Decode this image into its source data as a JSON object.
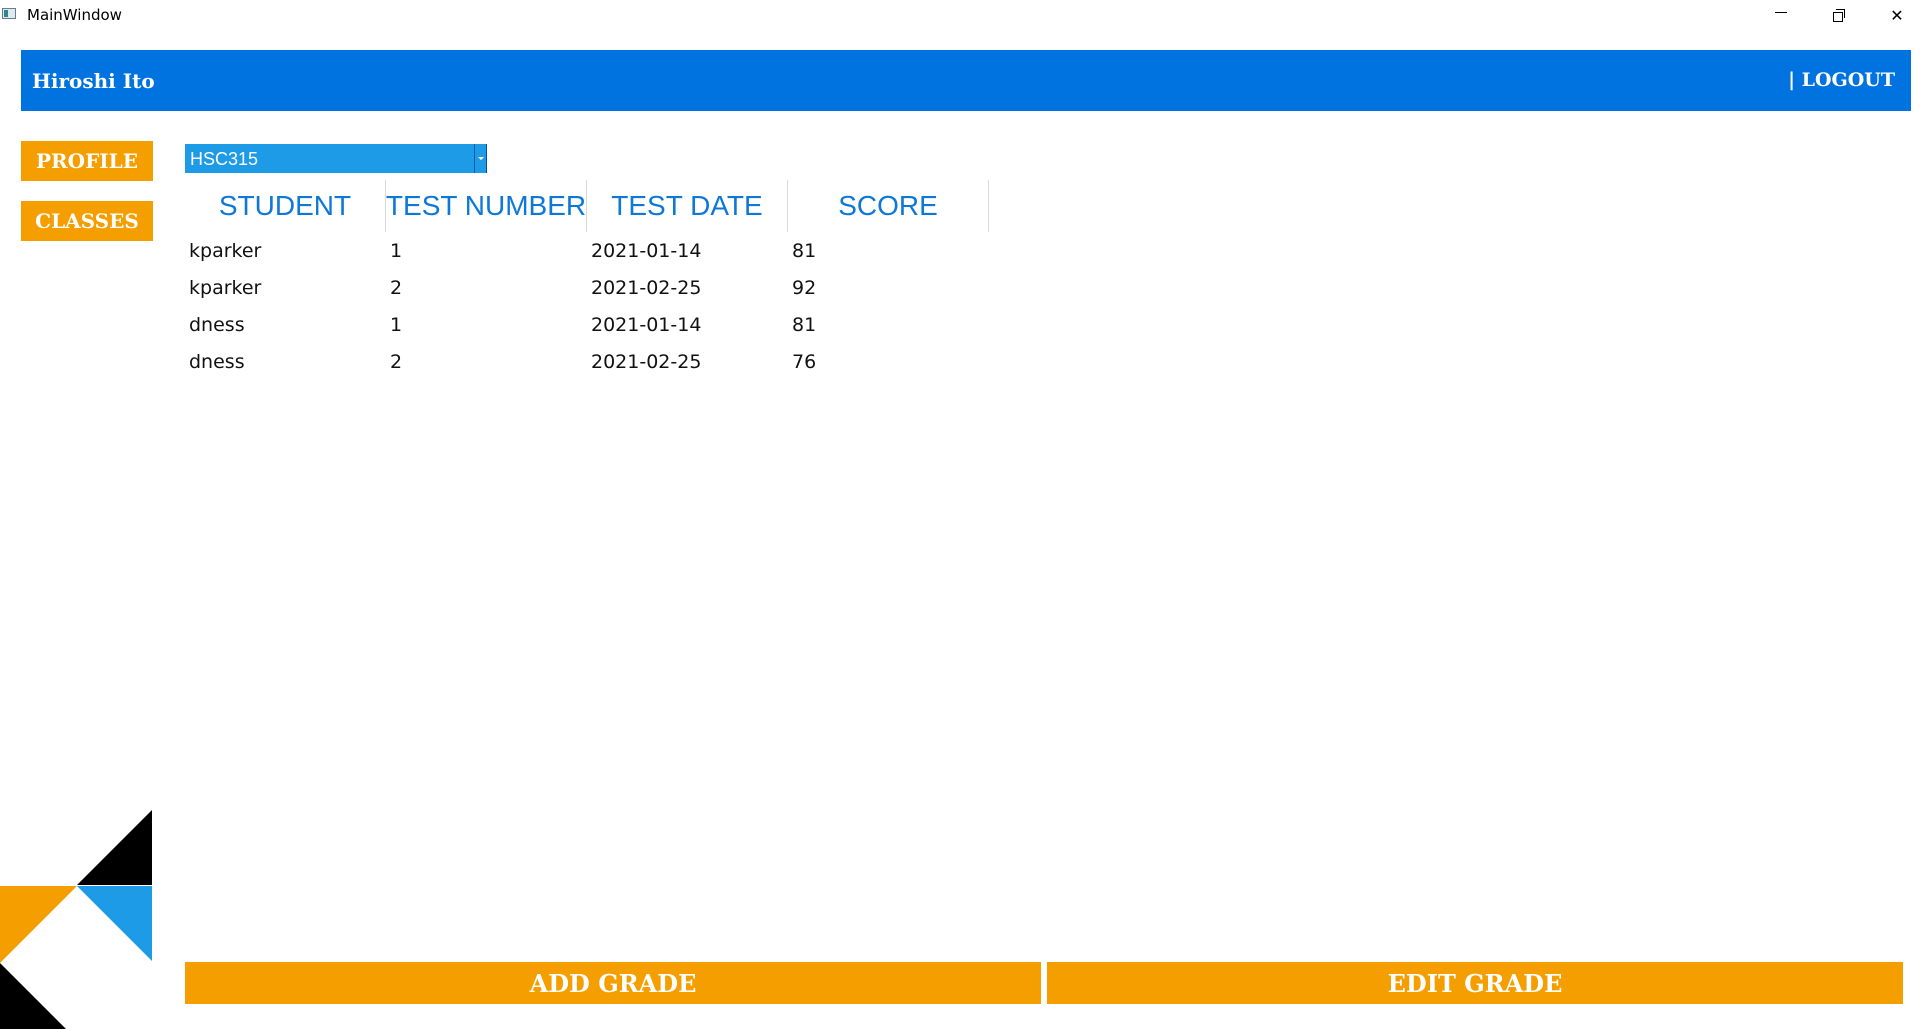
{
  "window": {
    "title": "MainWindow"
  },
  "header": {
    "user_name": "Hiroshi Ito",
    "logout_label": "| LOGOUT"
  },
  "sidebar": {
    "profile_label": "PROFILE",
    "classes_label": "CLASSES"
  },
  "class_select": {
    "selected": "HSC315"
  },
  "grid": {
    "columns": [
      "STUDENT",
      "TEST NUMBER",
      "TEST DATE",
      "SCORE"
    ],
    "rows": [
      [
        "kparker",
        "1",
        "2021-01-14",
        "81"
      ],
      [
        "kparker",
        "2",
        "2021-02-25",
        "92"
      ],
      [
        "dness",
        "1",
        "2021-01-14",
        "81"
      ],
      [
        "dness",
        "2",
        "2021-02-25",
        "76"
      ]
    ]
  },
  "actions": {
    "add_grade_label": "ADD GRADE",
    "edit_grade_label": "EDIT GRADE"
  },
  "colors": {
    "header_blue": "#0073e0",
    "accent_orange": "#f59e00",
    "select_blue": "#1e9be6",
    "column_header_blue": "#0d78d8"
  }
}
